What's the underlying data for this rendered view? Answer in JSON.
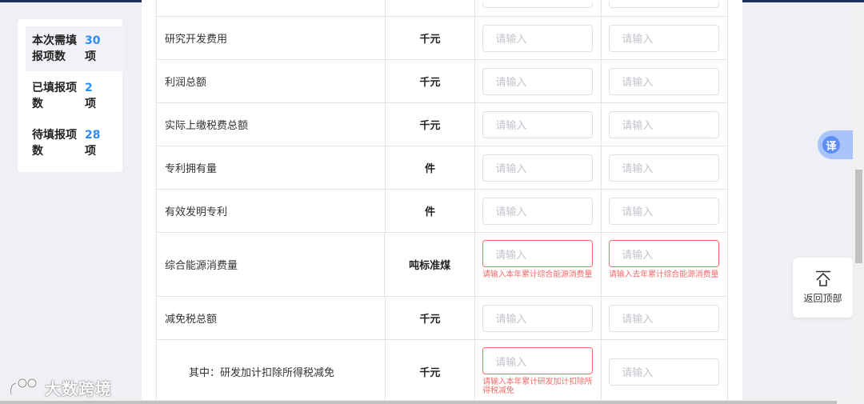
{
  "summary": {
    "items": [
      {
        "label": "本次需填报项数",
        "value": "30",
        "unit": "项"
      },
      {
        "label": "已填报项数",
        "value": "2",
        "unit": "项"
      },
      {
        "label": "待填报项数",
        "value": "28",
        "unit": "项"
      }
    ]
  },
  "table": {
    "rows": [
      {
        "name": "",
        "unit": "",
        "input1": "",
        "input2": ""
      },
      {
        "name": "研究开发费用",
        "unit": "千元",
        "input1": "请输入",
        "input2": "请输入"
      },
      {
        "name": "利润总额",
        "unit": "千元",
        "input1": "请输入",
        "input2": "请输入"
      },
      {
        "name": "实际上缴税费总额",
        "unit": "千元",
        "input1": "请输入",
        "input2": "请输入"
      },
      {
        "name": "专利拥有量",
        "unit": "件",
        "input1": "请输入",
        "input2": "请输入"
      },
      {
        "name": "有效发明专利",
        "unit": "件",
        "input1": "请输入",
        "input2": "请输入"
      },
      {
        "name": "综合能源消费量",
        "unit": "吨标准煤",
        "input1": "请输入",
        "input2": "请输入",
        "error1": "请输入本年累计综合能源消费量",
        "error2": "请输入去年累计综合能源消费量"
      },
      {
        "name": "减免税总额",
        "unit": "千元",
        "input1": "请输入",
        "input2": "请输入"
      },
      {
        "name": "其中：研发加计扣除所得税减免",
        "unit": "千元",
        "input1": "请输入",
        "input2": "请输入",
        "error1": "请输入本年累计研发加计扣除所得税减免"
      }
    ]
  },
  "widgets": {
    "translate_label": "译",
    "back_top_label": "返回顶部"
  },
  "watermark": "大数跨境",
  "colors": {
    "accent": "#2d8cf0",
    "error": "#f56c6c",
    "topbar": "#1f2f5c",
    "translate_bg": "#a9c3fb"
  }
}
